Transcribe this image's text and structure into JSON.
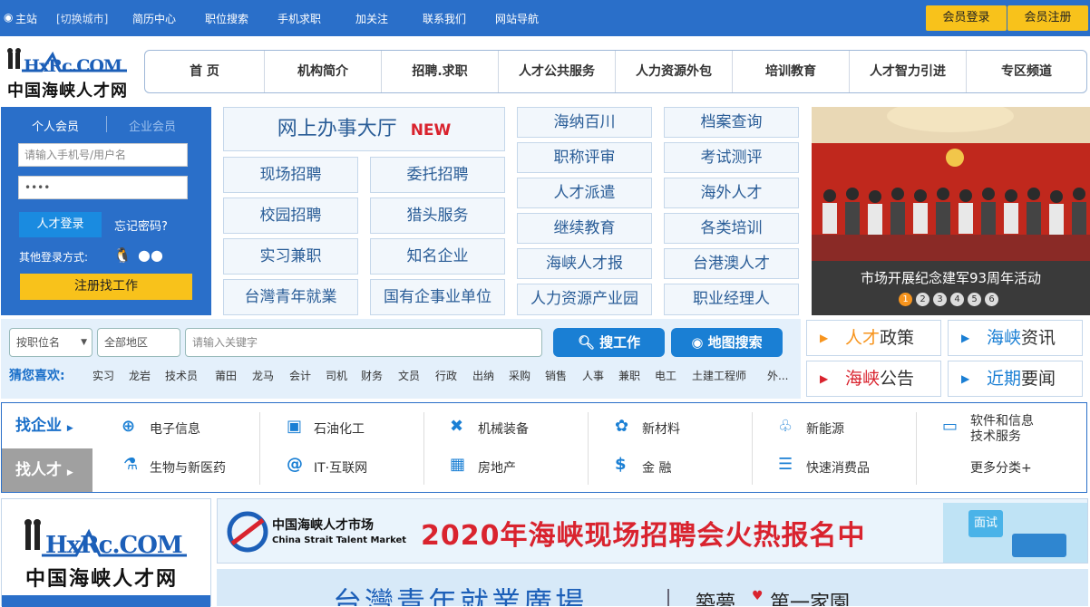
{
  "topbar": {
    "location": "主站",
    "switch_city": "[切换城市]",
    "links": [
      "简历中心",
      "职位搜索",
      "手机求职",
      "加关注",
      "联系我们",
      "网站导航"
    ],
    "member_login": "会员登录",
    "member_register": "会员注册"
  },
  "logo": {
    "latin": "HxRc.COM",
    "cn": "中国海峡人才网"
  },
  "nav": [
    "首 页",
    "机构简介",
    "招聘.求职",
    "人才公共服务",
    "人力资源外包",
    "培训教育",
    "人才智力引进",
    "专区频道"
  ],
  "login": {
    "tab_personal": "个人会员",
    "tab_company": "企业会员",
    "username_placeholder": "请输入手机号/用户名",
    "password_value": "••••",
    "login_button": "人才登录",
    "forgot": "忘记密码?",
    "other_login": "其他登录方式:",
    "register_button": "注册找工作"
  },
  "services": {
    "hall": "网上办事大厅",
    "hall_badge": "NEW",
    "grid": [
      "现场招聘",
      "委托招聘",
      "校园招聘",
      "猎头服务",
      "实习兼职",
      "知名企业",
      "台灣青年就業",
      "国有企事业单位"
    ],
    "grid2": [
      "海纳百川",
      "档案查询",
      "职称评审",
      "考试测评",
      "人才派遣",
      "海外人才",
      "继续教育",
      "各类培训",
      "海峡人才报",
      "台港澳人才",
      "人力资源产业园",
      "职业经理人"
    ]
  },
  "banner": {
    "caption": "市场开展纪念建军93周年活动",
    "pages": [
      "1",
      "2",
      "3",
      "4",
      "5",
      "6"
    ]
  },
  "search": {
    "type_select": "按职位名",
    "area_select": "全部地区",
    "keyword_placeholder": "请输入关键字",
    "search_button": "搜工作",
    "map_button": "地图搜索",
    "hot_label": "猜您喜欢:",
    "hot": [
      "实习",
      "龙岩",
      "技术员",
      "莆田",
      "龙马",
      "会计",
      "司机",
      "财务",
      "文员",
      "行政",
      "出纳",
      "采购",
      "销售",
      "人事",
      "兼职",
      "电工",
      "土建工程师",
      "外..."
    ]
  },
  "news": [
    {
      "hl": "人才",
      "rest": "政策"
    },
    {
      "hl": "海峡",
      "rest": "资讯"
    },
    {
      "hl": "海峡",
      "rest": "公告"
    },
    {
      "hl": "近期",
      "rest": "要闻"
    }
  ],
  "categories": {
    "tab_company": "找企业",
    "tab_talent": "找人才",
    "items": [
      "电子信息",
      "石油化工",
      "机械装备",
      "新材料",
      "新能源",
      "软件和信息",
      "技术服务",
      "生物与新医药",
      "IT·互联网",
      "房地产",
      "金 融",
      "快速消费品",
      "更多分类+"
    ]
  },
  "ads": {
    "ad1_cn": "中国海峡人才市场",
    "ad1_en": "China Strait Talent Market",
    "ad1_slogan": "2020年海峡现场招聘会火热报名中",
    "ad1_tag": "面试",
    "ad2_text": "台灣青年就業廣場",
    "ad2_sub": "築夢",
    "ad2_sub2": "第一家園"
  },
  "colors": {
    "brand_blue": "#2a6fc9",
    "yellow": "#f8c21b",
    "red": "#d9232e"
  }
}
